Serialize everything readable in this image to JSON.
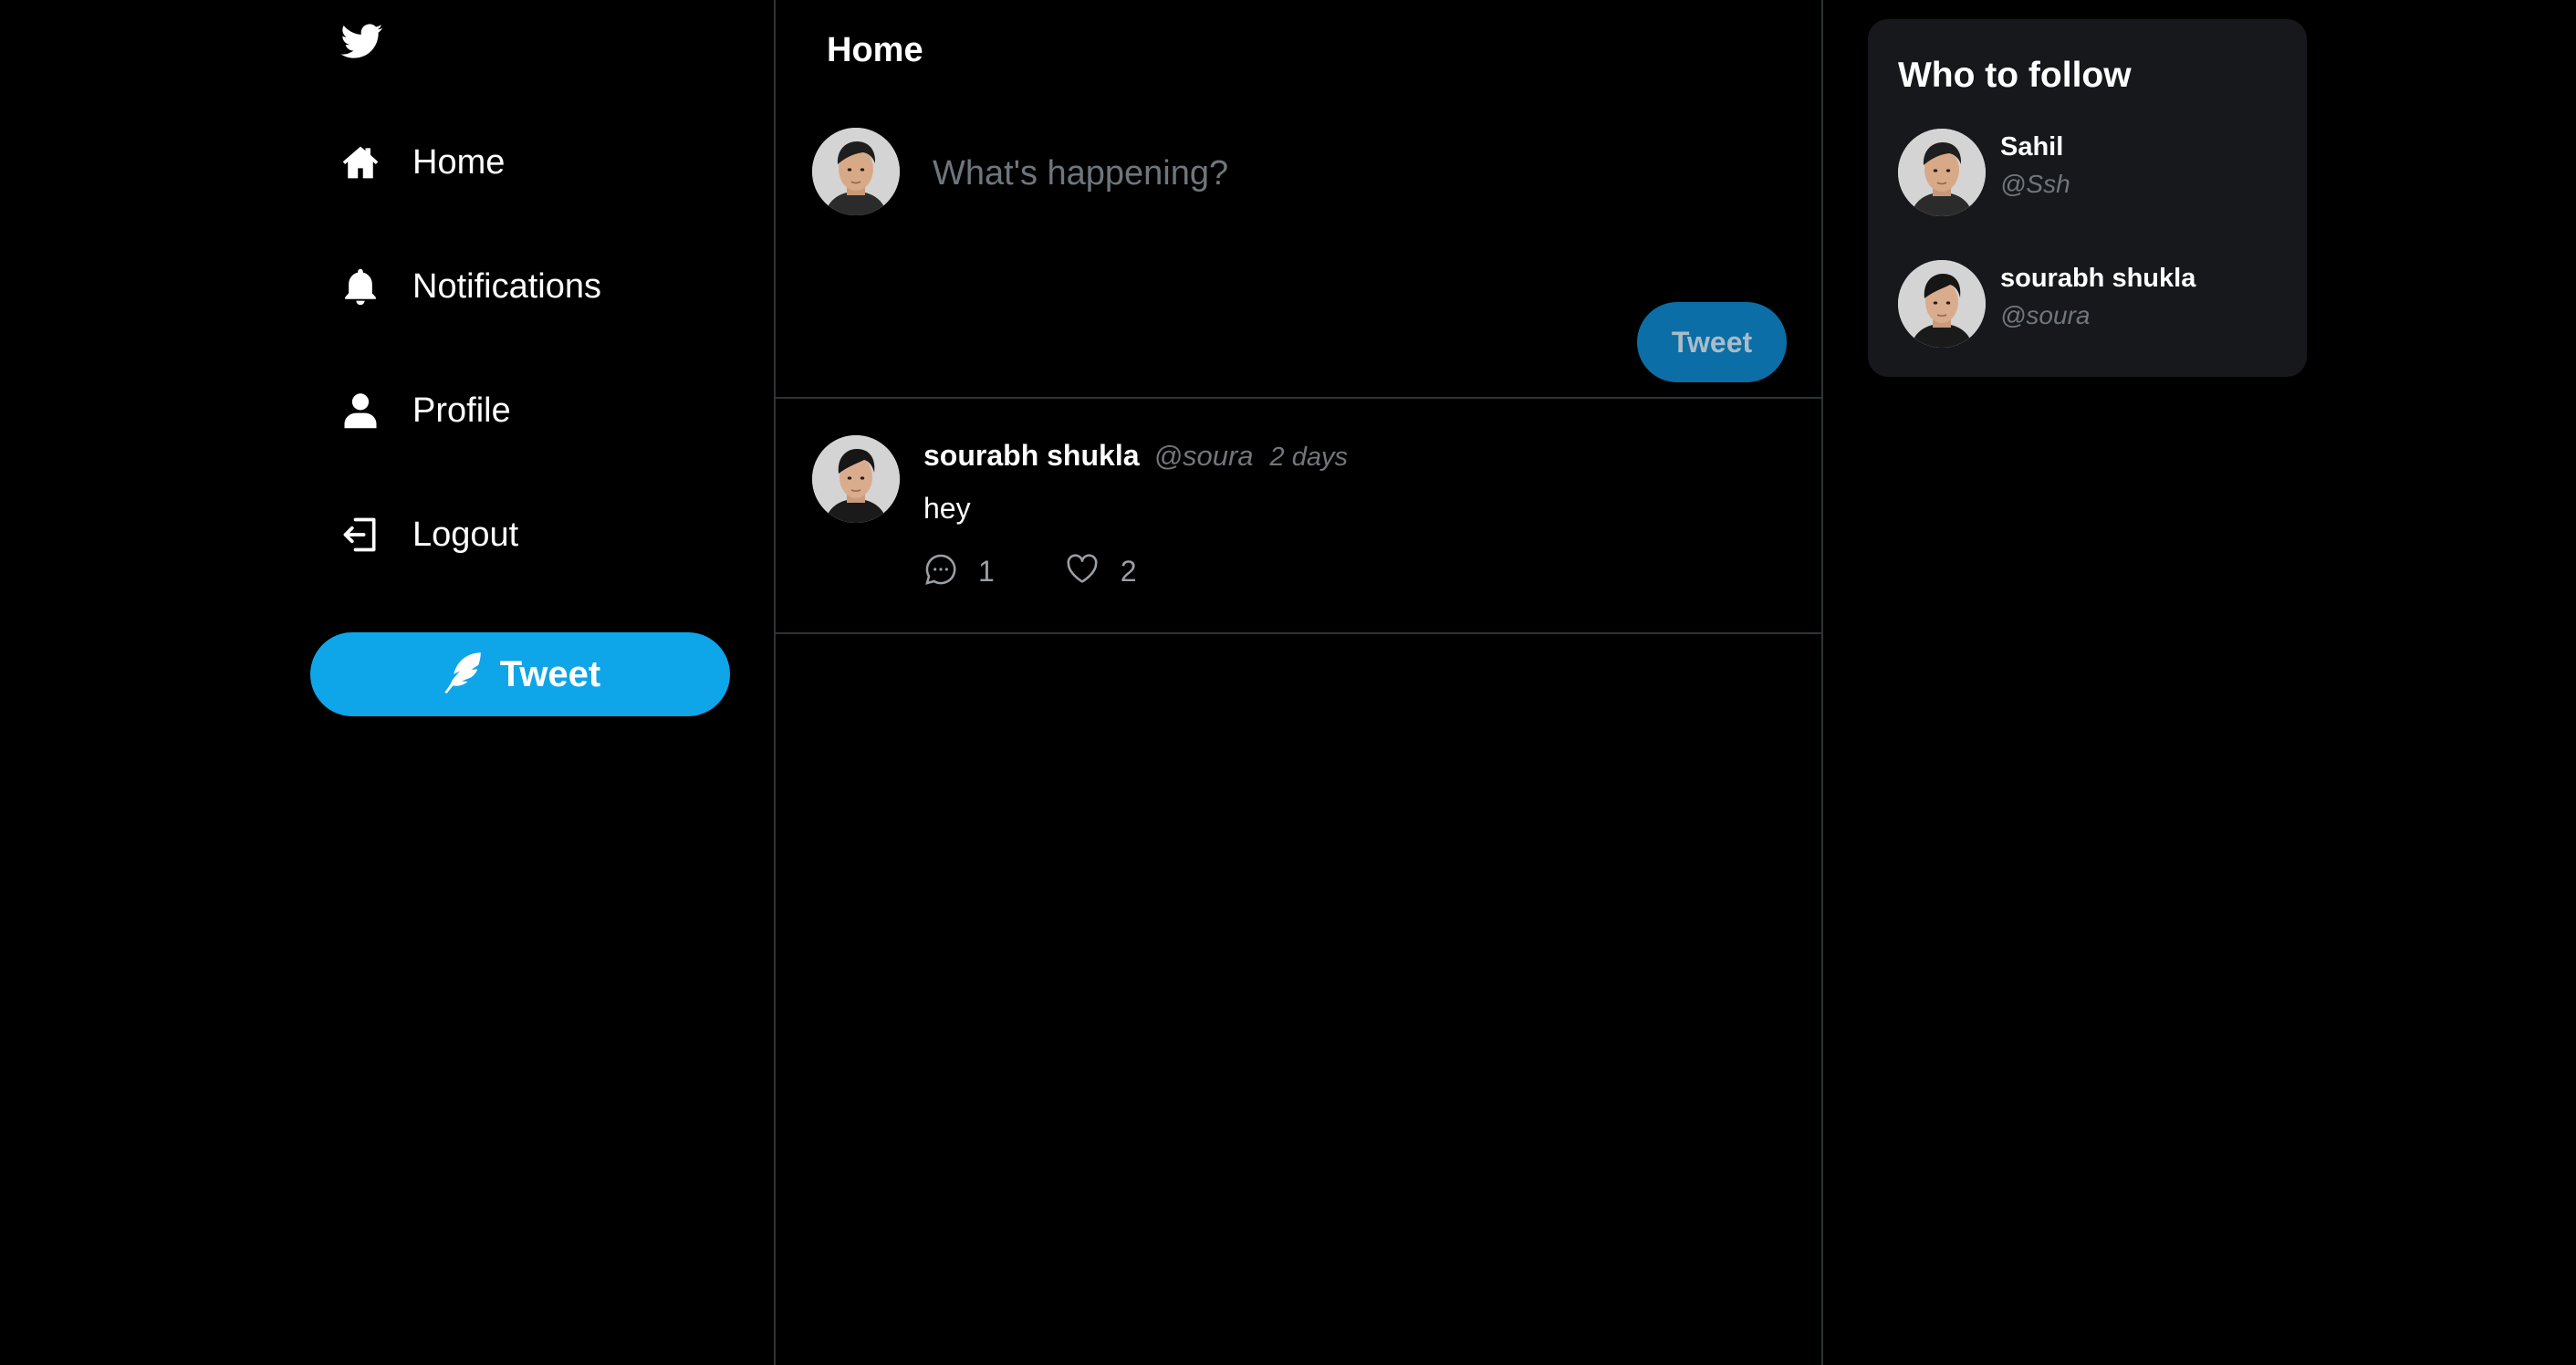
{
  "colors": {
    "background": "#000000",
    "accent": "#0ea5e9",
    "accent_dim": "#0c6ea6",
    "card": "#16181c",
    "border": "#2f3336",
    "muted": "#71767b"
  },
  "sidebar": {
    "logo_icon": "twitter-bird-icon",
    "items": [
      {
        "label": "Home",
        "icon": "home-icon"
      },
      {
        "label": "Notifications",
        "icon": "bell-icon"
      },
      {
        "label": "Profile",
        "icon": "user-icon"
      },
      {
        "label": "Logout",
        "icon": "logout-icon"
      }
    ],
    "tweet_button": {
      "label": "Tweet",
      "icon": "feather-icon"
    }
  },
  "main": {
    "title": "Home",
    "compose": {
      "placeholder": "What's happening?",
      "value": "",
      "button_label": "Tweet"
    },
    "posts": [
      {
        "name": "sourabh shukla",
        "handle": "@soura",
        "time": "2 days",
        "text": "hey",
        "comments": "1",
        "likes": "2"
      }
    ]
  },
  "right": {
    "title": "Who to follow",
    "suggestions": [
      {
        "name": "Sahil",
        "handle": "@Ssh"
      },
      {
        "name": "sourabh shukla",
        "handle": "@soura"
      }
    ]
  }
}
